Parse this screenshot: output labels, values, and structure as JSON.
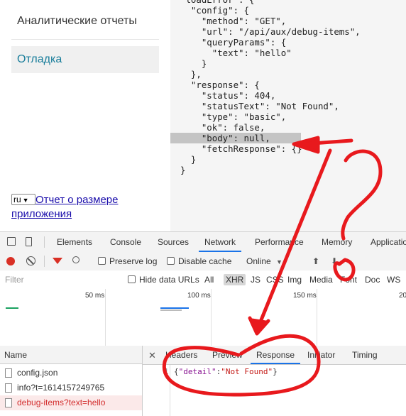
{
  "sidebar": {
    "items": [
      {
        "label": "Аналитические отчеты"
      },
      {
        "label": "Отладка"
      }
    ],
    "language": "ru",
    "size_report_link": "Отчет о размере приложения"
  },
  "json_view": {
    "lines": [
      "\"loadError\": {",
      "  \"config\": {",
      "    \"method\": \"GET\",",
      "    \"url\": \"/api/aux/debug-items\",",
      "    \"queryParams\": {",
      "      \"text\": \"hello\"",
      "    }",
      "  },",
      "  \"response\": {",
      "    \"status\": 404,",
      "    \"statusText\": \"Not Found\",",
      "    \"type\": \"basic\",",
      "    \"ok\": false,",
      "    \"body\": null,",
      "    \"fetchResponse\": {}",
      "  }",
      "}"
    ]
  },
  "devtools": {
    "tabs": [
      "Elements",
      "Console",
      "Sources",
      "Network",
      "Performance",
      "Memory",
      "Applicatio"
    ],
    "active_tab": "Network",
    "toolbar": {
      "preserve_log": "Preserve log",
      "disable_cache": "Disable cache",
      "throttle": "Online"
    },
    "filter": {
      "placeholder": "Filter",
      "hide_data_urls": "Hide data URLs",
      "types": [
        "All",
        "XHR",
        "JS",
        "CSS",
        "Img",
        "Media",
        "Font",
        "Doc",
        "WS"
      ],
      "active_type": "XHR"
    },
    "timeline_ticks": [
      "50 ms",
      "100 ms",
      "150 ms",
      "20"
    ],
    "requests": {
      "header": "Name",
      "rows": [
        {
          "name": "config.json",
          "status": "ok"
        },
        {
          "name": "info?t=1614157249765",
          "status": "ok"
        },
        {
          "name": "debug-items?text=hello",
          "status": "error"
        }
      ]
    },
    "detail_tabs": [
      "Headers",
      "Preview",
      "Response",
      "Initiator",
      "Timing"
    ],
    "active_detail_tab": "Response",
    "response": {
      "line_number": "1",
      "key": "\"detail\"",
      "value": "\"Not Found\""
    }
  },
  "colors": {
    "annotation": "#e8191d",
    "accent": "#1a73e8",
    "error_text": "#d32f2f",
    "debug_link": "#1a7e9b"
  }
}
